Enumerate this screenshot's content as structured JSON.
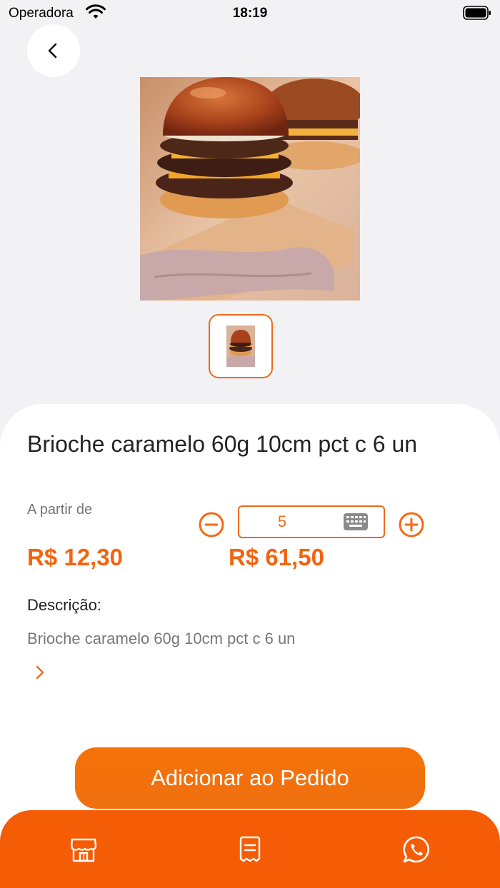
{
  "status_bar": {
    "carrier": "Operadora",
    "time": "18:19"
  },
  "product": {
    "name": "Brioche caramelo 60g 10cm pct c 6 un",
    "price_from_label": "A partir de",
    "unit_price": "R$ 12,30",
    "total_price": "R$ 61,50",
    "quantity": "5",
    "description_label": "Descrição:",
    "description": "Brioche caramelo 60g 10cm pct c 6 un"
  },
  "actions": {
    "add_to_order": "Adicionar ao Pedido"
  },
  "icons": {
    "back": "chevron-left-icon",
    "minus": "minus-circle-icon",
    "plus": "plus-circle-icon",
    "keyboard": "keyboard-icon",
    "expand": "chevron-right-icon",
    "nav_store": "store-icon",
    "nav_orders": "receipt-icon",
    "nav_whatsapp": "whatsapp-icon"
  },
  "colors": {
    "accent": "#f26a17",
    "bottom_nav": "#f55c06",
    "background": "#f2f2f4"
  }
}
